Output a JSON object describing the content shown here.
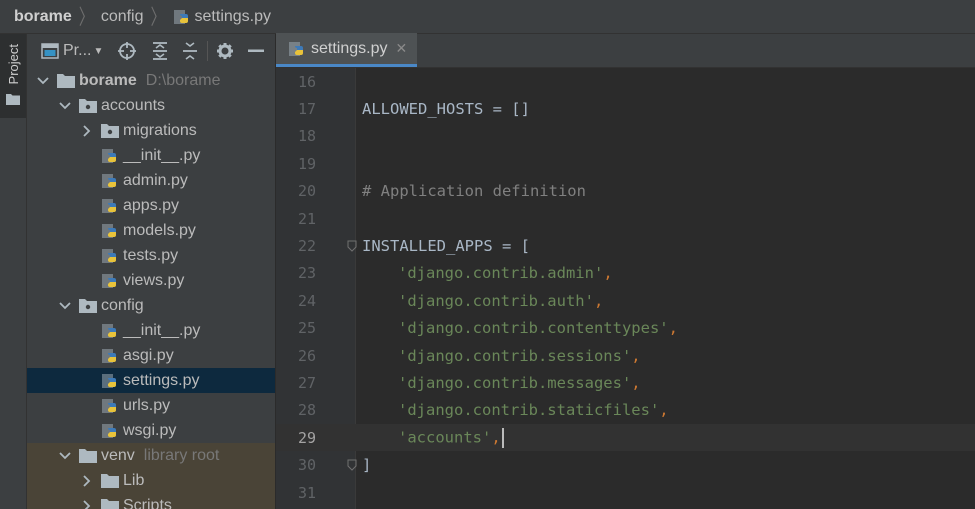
{
  "breadcrumb": {
    "project": "borame",
    "folder": "config",
    "file": "settings.py"
  },
  "stripe": {
    "label": "Project"
  },
  "project_toolbar": {
    "view_label": "Pr..."
  },
  "tree": [
    {
      "label": "borame",
      "hint": "D:\\borame",
      "depth": 0,
      "expanded": true,
      "type": "root",
      "bold": true
    },
    {
      "label": "accounts",
      "hint": "",
      "depth": 1,
      "expanded": true,
      "type": "package"
    },
    {
      "label": "migrations",
      "hint": "",
      "depth": 2,
      "expanded": false,
      "type": "package"
    },
    {
      "label": "__init__.py",
      "hint": "",
      "depth": 2,
      "type": "python"
    },
    {
      "label": "admin.py",
      "hint": "",
      "depth": 2,
      "type": "python"
    },
    {
      "label": "apps.py",
      "hint": "",
      "depth": 2,
      "type": "python"
    },
    {
      "label": "models.py",
      "hint": "",
      "depth": 2,
      "type": "python"
    },
    {
      "label": "tests.py",
      "hint": "",
      "depth": 2,
      "type": "python"
    },
    {
      "label": "views.py",
      "hint": "",
      "depth": 2,
      "type": "python"
    },
    {
      "label": "config",
      "hint": "",
      "depth": 1,
      "expanded": true,
      "type": "package"
    },
    {
      "label": "__init__.py",
      "hint": "",
      "depth": 2,
      "type": "python"
    },
    {
      "label": "asgi.py",
      "hint": "",
      "depth": 2,
      "type": "python"
    },
    {
      "label": "settings.py",
      "hint": "",
      "depth": 2,
      "type": "python",
      "selected": true
    },
    {
      "label": "urls.py",
      "hint": "",
      "depth": 2,
      "type": "python"
    },
    {
      "label": "wsgi.py",
      "hint": "",
      "depth": 2,
      "type": "python"
    },
    {
      "label": "venv",
      "hint": "library root",
      "depth": 1,
      "expanded": true,
      "type": "folder",
      "excluded": true
    },
    {
      "label": "Lib",
      "hint": "",
      "depth": 2,
      "expanded": false,
      "type": "folder",
      "excluded": true
    },
    {
      "label": "Scripts",
      "hint": "",
      "depth": 2,
      "expanded": false,
      "type": "folder",
      "excluded": true
    }
  ],
  "editor": {
    "tab_label": "settings.py",
    "current_line": 29,
    "lines": [
      {
        "num": "16",
        "text": ""
      },
      {
        "num": "17",
        "text": "ALLOWED_HOSTS = []"
      },
      {
        "num": "18",
        "text": ""
      },
      {
        "num": "19",
        "text": ""
      },
      {
        "num": "20",
        "text": "# Application definition"
      },
      {
        "num": "21",
        "text": ""
      },
      {
        "num": "22",
        "text": "INSTALLED_APPS = ["
      },
      {
        "num": "23",
        "text": "    'django.contrib.admin',"
      },
      {
        "num": "24",
        "text": "    'django.contrib.auth',"
      },
      {
        "num": "25",
        "text": "    'django.contrib.contenttypes',"
      },
      {
        "num": "26",
        "text": "    'django.contrib.sessions',"
      },
      {
        "num": "27",
        "text": "    'django.contrib.messages',"
      },
      {
        "num": "28",
        "text": "    'django.contrib.staticfiles',"
      },
      {
        "num": "29",
        "text": "    'accounts',"
      },
      {
        "num": "30",
        "text": "]"
      },
      {
        "num": "31",
        "text": ""
      }
    ]
  },
  "colors": {
    "accent_tab": "#4a88c7",
    "selection": "#0d293e",
    "excluded": "#4a4437",
    "string": "#6a8759",
    "comment": "#808080",
    "keyword": "#cc7832"
  },
  "icons": {
    "breadcrumb_file": "python-file-icon",
    "locate": "crosshair-icon",
    "expand_all": "expand-all-icon",
    "collapse_all": "collapse-all-icon",
    "settings": "gear-icon",
    "hide": "minimize-icon"
  }
}
